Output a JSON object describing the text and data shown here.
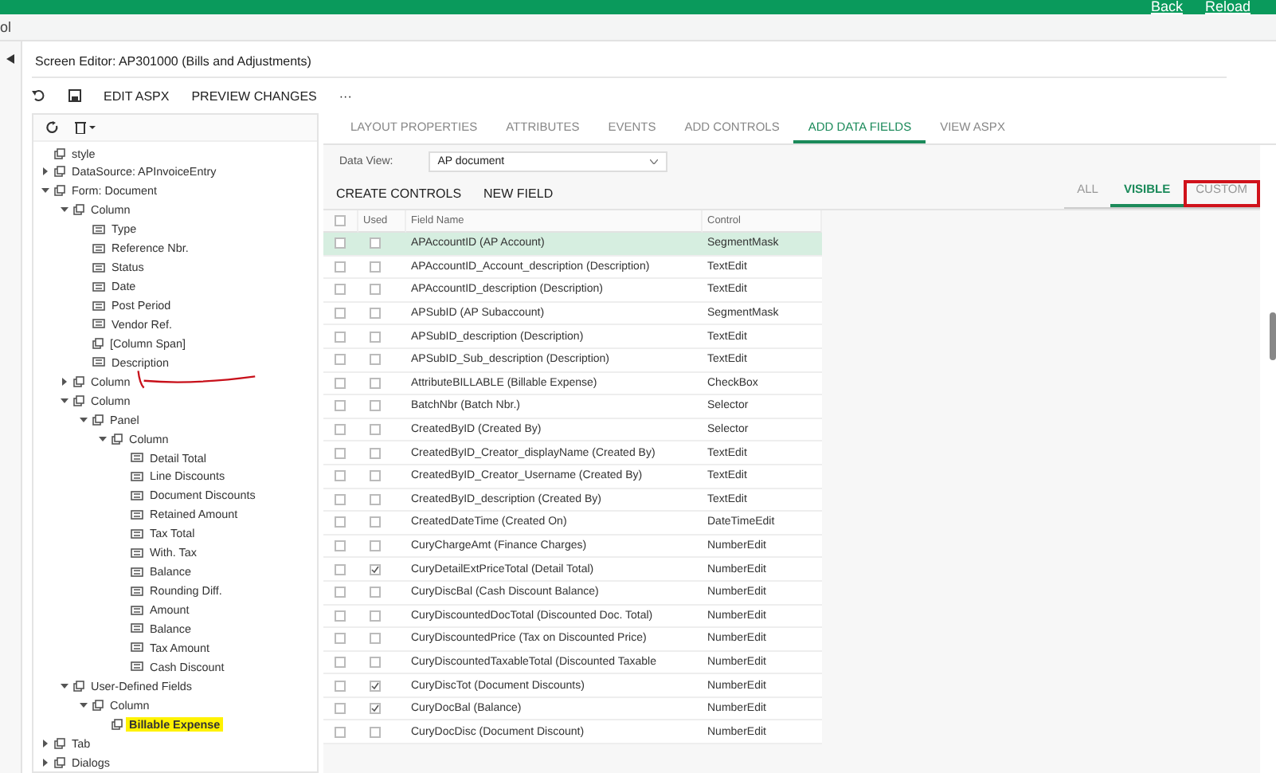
{
  "top_links": [
    "Back",
    "Reload"
  ],
  "breadcrumb_fragment": "ol",
  "screen_title": "Screen Editor: AP301000 (Bills and Adjustments)",
  "toolbar": {
    "actions": [
      "EDIT ASPX",
      "PREVIEW CHANGES"
    ],
    "more": "···"
  },
  "tree": [
    {
      "label": "style",
      "kind": "group"
    },
    {
      "label": "DataSource: APInvoiceEntry",
      "kind": "group",
      "expanded": false
    },
    {
      "label": "Form: Document",
      "kind": "group",
      "expanded": true,
      "children": [
        {
          "label": "Column",
          "kind": "group",
          "expanded": true,
          "children": [
            {
              "label": "Type",
              "kind": "field"
            },
            {
              "label": "Reference Nbr.",
              "kind": "field"
            },
            {
              "label": "Status",
              "kind": "field"
            },
            {
              "label": "Date",
              "kind": "field"
            },
            {
              "label": "Post Period",
              "kind": "field"
            },
            {
              "label": "Vendor Ref.",
              "kind": "field"
            },
            {
              "label": "[Column Span]",
              "kind": "group"
            },
            {
              "label": "Description",
              "kind": "field"
            }
          ]
        },
        {
          "label": "Column",
          "kind": "group",
          "expanded": false
        },
        {
          "label": "Column",
          "kind": "group",
          "expanded": true,
          "children": [
            {
              "label": "Panel",
              "kind": "group",
              "expanded": true,
              "children": [
                {
                  "label": "Column",
                  "kind": "group",
                  "expanded": true,
                  "children": [
                    {
                      "label": "Detail Total",
                      "kind": "field"
                    },
                    {
                      "label": "Line Discounts",
                      "kind": "field"
                    },
                    {
                      "label": "Document Discounts",
                      "kind": "field"
                    },
                    {
                      "label": "Retained Amount",
                      "kind": "field"
                    },
                    {
                      "label": "Tax Total",
                      "kind": "field"
                    },
                    {
                      "label": "With. Tax",
                      "kind": "field"
                    },
                    {
                      "label": "Balance",
                      "kind": "field"
                    },
                    {
                      "label": "Rounding Diff.",
                      "kind": "field"
                    },
                    {
                      "label": "Amount",
                      "kind": "field"
                    },
                    {
                      "label": "Balance",
                      "kind": "field"
                    },
                    {
                      "label": "Tax Amount",
                      "kind": "field"
                    },
                    {
                      "label": "Cash Discount",
                      "kind": "field"
                    }
                  ]
                }
              ]
            }
          ]
        },
        {
          "label": "User-Defined Fields",
          "kind": "group",
          "expanded": true,
          "children": [
            {
              "label": "Column",
              "kind": "group",
              "expanded": true,
              "children": [
                {
                  "label": "Billable Expense",
                  "kind": "group",
                  "highlighted": true
                }
              ]
            }
          ]
        }
      ]
    },
    {
      "label": "Tab",
      "kind": "group",
      "expanded": false
    },
    {
      "label": "Dialogs",
      "kind": "group",
      "expanded": false
    }
  ],
  "tabs": [
    {
      "label": "LAYOUT PROPERTIES",
      "selected": false
    },
    {
      "label": "ATTRIBUTES",
      "selected": false
    },
    {
      "label": "EVENTS",
      "selected": false
    },
    {
      "label": "ADD CONTROLS",
      "selected": false
    },
    {
      "label": "ADD DATA FIELDS",
      "selected": true
    },
    {
      "label": "VIEW ASPX",
      "selected": false
    }
  ],
  "data_view": {
    "label": "Data View:",
    "value": "AP document"
  },
  "actions": [
    "CREATE CONTROLS",
    "NEW FIELD"
  ],
  "filters": [
    {
      "label": "ALL",
      "selected": false,
      "marked": false
    },
    {
      "label": "VISIBLE",
      "selected": true,
      "marked": false
    },
    {
      "label": "CUSTOM",
      "selected": false,
      "marked": true
    }
  ],
  "table": {
    "all_checked": false,
    "columns": [
      "Used",
      "Field Name",
      "Control"
    ],
    "rows": [
      {
        "selected": true,
        "checked": false,
        "used": false,
        "field": "APAccountID (AP Account)",
        "control": "SegmentMask"
      },
      {
        "selected": false,
        "checked": false,
        "used": false,
        "field": "APAccountID_Account_description (Description)",
        "control": "TextEdit"
      },
      {
        "selected": false,
        "checked": false,
        "used": false,
        "field": "APAccountID_description (Description)",
        "control": "TextEdit"
      },
      {
        "selected": false,
        "checked": false,
        "used": false,
        "field": "APSubID (AP Subaccount)",
        "control": "SegmentMask"
      },
      {
        "selected": false,
        "checked": false,
        "used": false,
        "field": "APSubID_description (Description)",
        "control": "TextEdit"
      },
      {
        "selected": false,
        "checked": false,
        "used": false,
        "field": "APSubID_Sub_description (Description)",
        "control": "TextEdit"
      },
      {
        "selected": false,
        "checked": false,
        "used": false,
        "field": "AttributeBILLABLE (Billable Expense)",
        "control": "CheckBox"
      },
      {
        "selected": false,
        "checked": false,
        "used": false,
        "field": "BatchNbr (Batch Nbr.)",
        "control": "Selector"
      },
      {
        "selected": false,
        "checked": false,
        "used": false,
        "field": "CreatedByID (Created By)",
        "control": "Selector"
      },
      {
        "selected": false,
        "checked": false,
        "used": false,
        "field": "CreatedByID_Creator_displayName (Created By)",
        "control": "TextEdit"
      },
      {
        "selected": false,
        "checked": false,
        "used": false,
        "field": "CreatedByID_Creator_Username (Created By)",
        "control": "TextEdit"
      },
      {
        "selected": false,
        "checked": false,
        "used": false,
        "field": "CreatedByID_description (Created By)",
        "control": "TextEdit"
      },
      {
        "selected": false,
        "checked": false,
        "used": false,
        "field": "CreatedDateTime (Created On)",
        "control": "DateTimeEdit"
      },
      {
        "selected": false,
        "checked": false,
        "used": false,
        "field": "CuryChargeAmt (Finance Charges)",
        "control": "NumberEdit"
      },
      {
        "selected": false,
        "checked": false,
        "used": true,
        "field": "CuryDetailExtPriceTotal (Detail Total)",
        "control": "NumberEdit"
      },
      {
        "selected": false,
        "checked": false,
        "used": false,
        "field": "CuryDiscBal (Cash Discount Balance)",
        "control": "NumberEdit"
      },
      {
        "selected": false,
        "checked": false,
        "used": false,
        "field": "CuryDiscountedDocTotal (Discounted Doc. Total)",
        "control": "NumberEdit"
      },
      {
        "selected": false,
        "checked": false,
        "used": false,
        "field": "CuryDiscountedPrice (Tax on Discounted Price)",
        "control": "NumberEdit"
      },
      {
        "selected": false,
        "checked": false,
        "used": false,
        "field": "CuryDiscountedTaxableTotal (Discounted Taxable",
        "control": "NumberEdit"
      },
      {
        "selected": false,
        "checked": false,
        "used": true,
        "field": "CuryDiscTot (Document Discounts)",
        "control": "NumberEdit"
      },
      {
        "selected": false,
        "checked": false,
        "used": true,
        "field": "CuryDocBal (Balance)",
        "control": "NumberEdit"
      },
      {
        "selected": false,
        "checked": false,
        "used": false,
        "field": "CuryDocDisc (Document Discount)",
        "control": "NumberEdit"
      }
    ]
  }
}
